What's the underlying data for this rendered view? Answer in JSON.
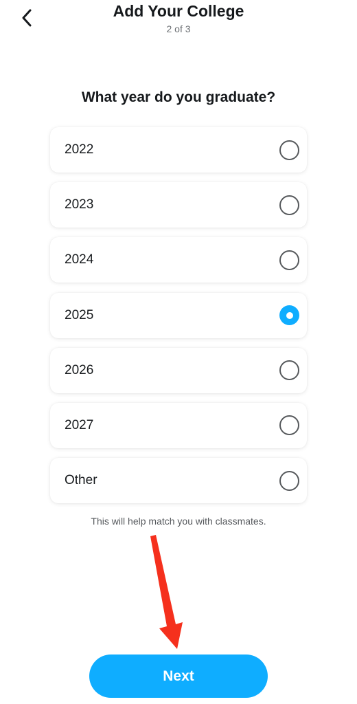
{
  "header": {
    "title": "Add Your College",
    "step": "2 of 3",
    "back_icon": "chevron-left-icon"
  },
  "question": "What year do you graduate?",
  "options": [
    {
      "label": "2022",
      "selected": false
    },
    {
      "label": "2023",
      "selected": false
    },
    {
      "label": "2024",
      "selected": false
    },
    {
      "label": "2025",
      "selected": true
    },
    {
      "label": "2026",
      "selected": false
    },
    {
      "label": "2027",
      "selected": false
    },
    {
      "label": "Other",
      "selected": false
    }
  ],
  "helper_text": "This will help match you with classmates.",
  "next_button": {
    "label": "Next"
  },
  "colors": {
    "accent": "#0fadff",
    "annotation_arrow": "#f5301d",
    "text": "#16191c"
  }
}
